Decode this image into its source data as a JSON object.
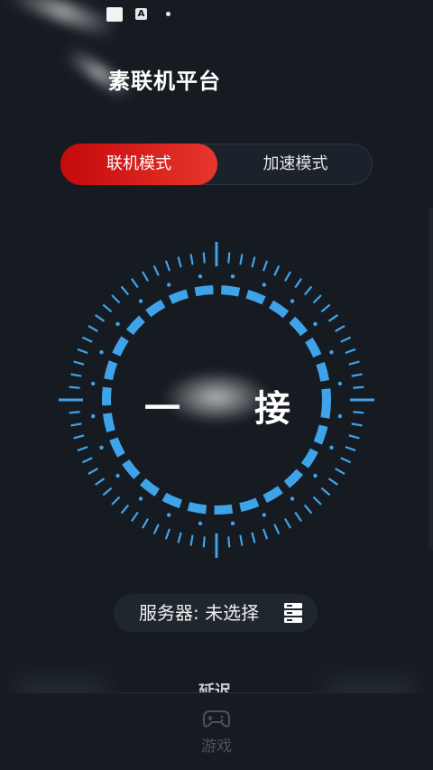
{
  "app": {
    "title": "素联机平台"
  },
  "status_bar": {
    "badge": "A"
  },
  "mode_toggle": {
    "tabs": [
      {
        "label": "联机模式",
        "active": true
      },
      {
        "label": "加速模式",
        "active": false
      }
    ]
  },
  "connect": {
    "left_char": "一",
    "right_char": "接"
  },
  "server": {
    "label": "服务器:",
    "value": "未选择",
    "icon": "server-list-icon"
  },
  "partial_label": "延迟",
  "bottom_nav": {
    "items": [
      {
        "label": "游戏",
        "icon": "gamepad-icon"
      }
    ]
  },
  "colors": {
    "accent_red": "#d8201c",
    "dial_blue": "#3fa3ea",
    "background": "#161b22"
  }
}
